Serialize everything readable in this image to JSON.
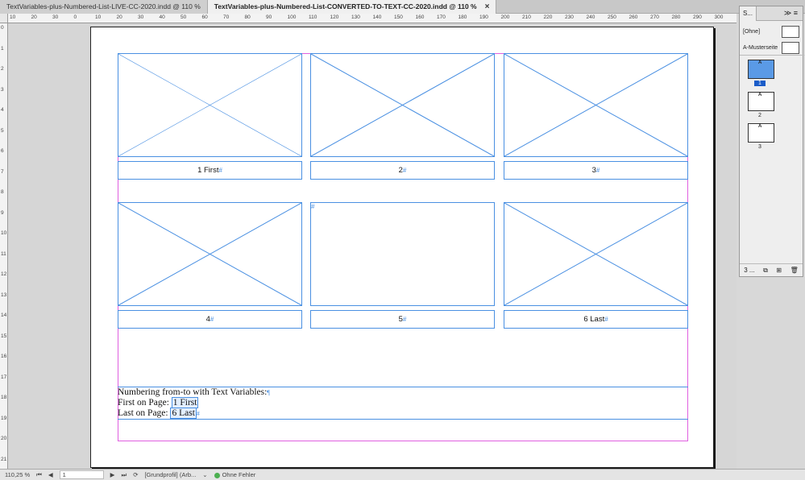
{
  "tabs": [
    {
      "label": "TextVariables-plus-Numbered-List-LIVE-CC-2020.indd @ 110 %",
      "active": false
    },
    {
      "label": "TextVariables-plus-Numbered-List-CONVERTED-TO-TEXT-CC-2020.indd @ 110 %",
      "active": true
    }
  ],
  "tab_close": "×",
  "hruler": [
    "10",
    "20",
    "30",
    "0",
    "10",
    "20",
    "30",
    "40",
    "50",
    "60",
    "70",
    "80",
    "90",
    "100",
    "110",
    "120",
    "130",
    "140",
    "150",
    "160",
    "170",
    "180",
    "190",
    "200",
    "210",
    "220",
    "230",
    "240",
    "250",
    "260",
    "270",
    "280",
    "290",
    "300"
  ],
  "vruler": [
    "0",
    "1",
    "2",
    "3",
    "4",
    "5",
    "6",
    "7",
    "8",
    "9",
    "10",
    "11",
    "12",
    "13",
    "14",
    "15",
    "16",
    "17",
    "18",
    "19",
    "20",
    "21"
  ],
  "captions": {
    "c1": "1 First",
    "c2": "2",
    "c3": "3",
    "c4": "4",
    "c5": "5",
    "c6": "6 Last",
    "pilcrow": "#",
    "end_mark": "¶"
  },
  "text_block": {
    "line1": "Numbering from-to with Text Variables:",
    "line2_prefix": "First on Page:",
    "line2_var": "1 First",
    "line3_prefix": "Last on Page:",
    "line3_var": "6 Last"
  },
  "pages_panel": {
    "tab_label": "S...",
    "menu": "≫ ≡",
    "master_none": "[Ohne]",
    "master_a": "A-Musterseite",
    "page_labels": [
      "1",
      "2",
      "3"
    ],
    "thumb_letter": "A",
    "footer_label": "3 ...",
    "footer_icons": [
      "pages-options-icon",
      "new-page-icon",
      "trash-icon"
    ]
  },
  "statusbar": {
    "zoom": "110,25 %",
    "page": "1",
    "profile": "[Grundprofil] (Arb...",
    "preflight": "Ohne Fehler"
  }
}
